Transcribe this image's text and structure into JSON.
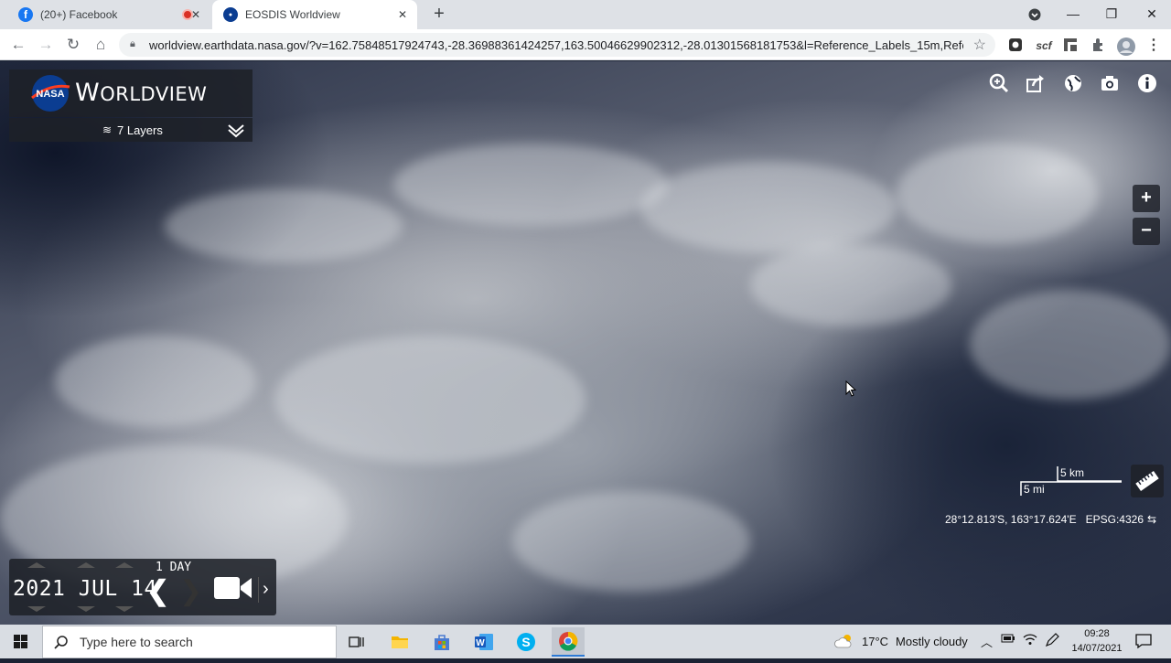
{
  "browser": {
    "tabs": [
      {
        "title": "(20+) Facebook",
        "icon": "facebook-icon",
        "active": false
      },
      {
        "title": "EOSDIS Worldview",
        "icon": "nasa-icon",
        "active": true
      }
    ],
    "url": "worldview.earthdata.nasa.gov/?v=162.75848517924743,-28.36988361424257,163.50046629902312,-28.01301568181753&l=Reference_Labels_15m,Refe...",
    "extensions": {
      "scf_label": "scf"
    }
  },
  "worldview": {
    "title_big": "W",
    "title_rest": "ORLDVIEW",
    "layers_label": "7 Layers",
    "scale_km": "5 km",
    "scale_mi": "5 mi",
    "coordinates": "28°12.813'S, 163°17.624'E",
    "projection": "EPSG:4326",
    "timeline": {
      "date": "2021 JUL 14",
      "interval": "1 DAY"
    }
  },
  "taskbar": {
    "search_placeholder": "Type here to search",
    "weather_temp": "17°C",
    "weather_desc": "Mostly cloudy",
    "time": "09:28",
    "date": "14/07/2021"
  },
  "colors": {
    "facebook": "#1877f2",
    "nasa_blue": "#0b3d91",
    "nasa_red": "#fc3d21",
    "record": "#d93025"
  }
}
